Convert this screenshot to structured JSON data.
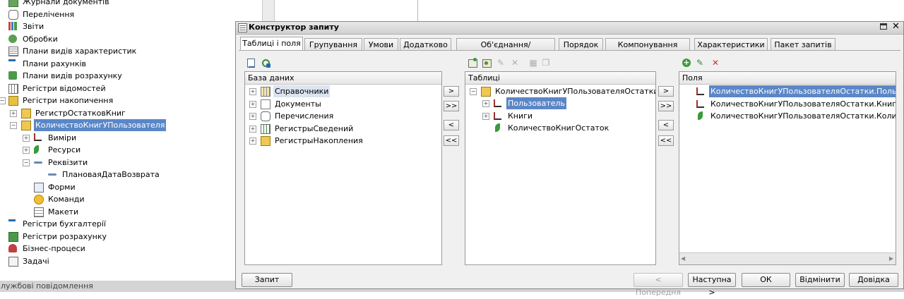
{
  "left_tree": {
    "items": [
      {
        "label": "Журнали документів",
        "icon": "journal-icon",
        "level": 0
      },
      {
        "label": "Перелічення",
        "icon": "enum-icon",
        "level": 0
      },
      {
        "label": "Звіти",
        "icon": "report-icon",
        "level": 0
      },
      {
        "label": "Обробки",
        "icon": "processing-icon",
        "level": 0
      },
      {
        "label": "Плани видів характеристик",
        "icon": "chart-of-characteristics-icon",
        "level": 0
      },
      {
        "label": "Плани рахунків",
        "icon": "chart-of-accounts-icon",
        "level": 0
      },
      {
        "label": "Плани видів розрахунку",
        "icon": "chart-of-calc-icon",
        "level": 0
      },
      {
        "label": "Регістри відомостей",
        "icon": "info-register-icon",
        "level": 0
      },
      {
        "label": "Регістри накопичення",
        "icon": "accum-register-icon",
        "level": 0
      },
      {
        "label": "РегистрОстатковКниг",
        "icon": "register-icon",
        "level": 1
      },
      {
        "label": "КоличествоКнигУПользователя",
        "icon": "register-icon",
        "level": 1
      },
      {
        "label": "Виміри",
        "icon": "dimension-icon",
        "level": 2
      },
      {
        "label": "Ресурси",
        "icon": "resource-icon",
        "level": 2
      },
      {
        "label": "Реквізити",
        "icon": "attribute-icon",
        "level": 2
      },
      {
        "label": "ПлановаяДатаВозврата",
        "icon": "attribute-icon",
        "level": 3
      },
      {
        "label": "Форми",
        "icon": "form-icon",
        "level": 2
      },
      {
        "label": "Команди",
        "icon": "command-icon",
        "level": 2
      },
      {
        "label": "Макети",
        "icon": "template-icon",
        "level": 2
      },
      {
        "label": "Регістри бухгалтерії",
        "icon": "accounting-register-icon",
        "level": 0
      },
      {
        "label": "Регістри розрахунку",
        "icon": "calc-register-icon",
        "level": 0
      },
      {
        "label": "Бізнес-процеси",
        "icon": "business-process-icon",
        "level": 0
      },
      {
        "label": "Задачі",
        "icon": "task-icon",
        "level": 0
      }
    ],
    "selected_index": 10
  },
  "status_bar": {
    "text": "лужбові повідомлення"
  },
  "dialog": {
    "title": "Конструктор запиту",
    "tabs": [
      {
        "label": "Таблиці і поля",
        "active": true
      },
      {
        "label": "Групування"
      },
      {
        "label": "Умови"
      },
      {
        "label": "Додатково"
      },
      {
        "label": "Об'єднання/Псевдоніми"
      },
      {
        "label": "Порядок"
      },
      {
        "label": "Компонування даних"
      },
      {
        "label": "Характеристики"
      },
      {
        "label": "Пакет запитів"
      }
    ],
    "database_pane": {
      "header": "База даних",
      "items": [
        {
          "label": "Справочники",
          "selected": true
        },
        {
          "label": "Документы"
        },
        {
          "label": "Перечисления"
        },
        {
          "label": "РегистрыСведений"
        },
        {
          "label": "РегистрыНакопления"
        }
      ]
    },
    "tables_pane": {
      "header": "Таблиці",
      "root": "КоличествоКнигУПользователяОстатки",
      "children": [
        {
          "label": "Пользователь",
          "selected": true
        },
        {
          "label": "Книги"
        },
        {
          "label": "КоличествоКнигОстаток"
        }
      ]
    },
    "fields_pane": {
      "header": "Поля",
      "items": [
        {
          "label": "КоличествоКнигУПользователяОстатки.Пользова",
          "selected": true
        },
        {
          "label": "КоличествоКнигУПользователяОстатки.Книги"
        },
        {
          "label": "КоличествоКнигУПользователяОстатки.Количест"
        }
      ]
    },
    "move_buttons": {
      "one_right": ">",
      "all_right": ">>",
      "one_left": "<",
      "all_left": "<<"
    },
    "buttons": {
      "query": "Запит",
      "prev": "< Попередня",
      "next": "Наступна >",
      "ok": "ОК",
      "cancel": "Відмінити",
      "help": "Довідка"
    },
    "colors": {
      "selection": "#5b87c7",
      "add": "#3a9a3a",
      "delete": "#d03030"
    }
  }
}
